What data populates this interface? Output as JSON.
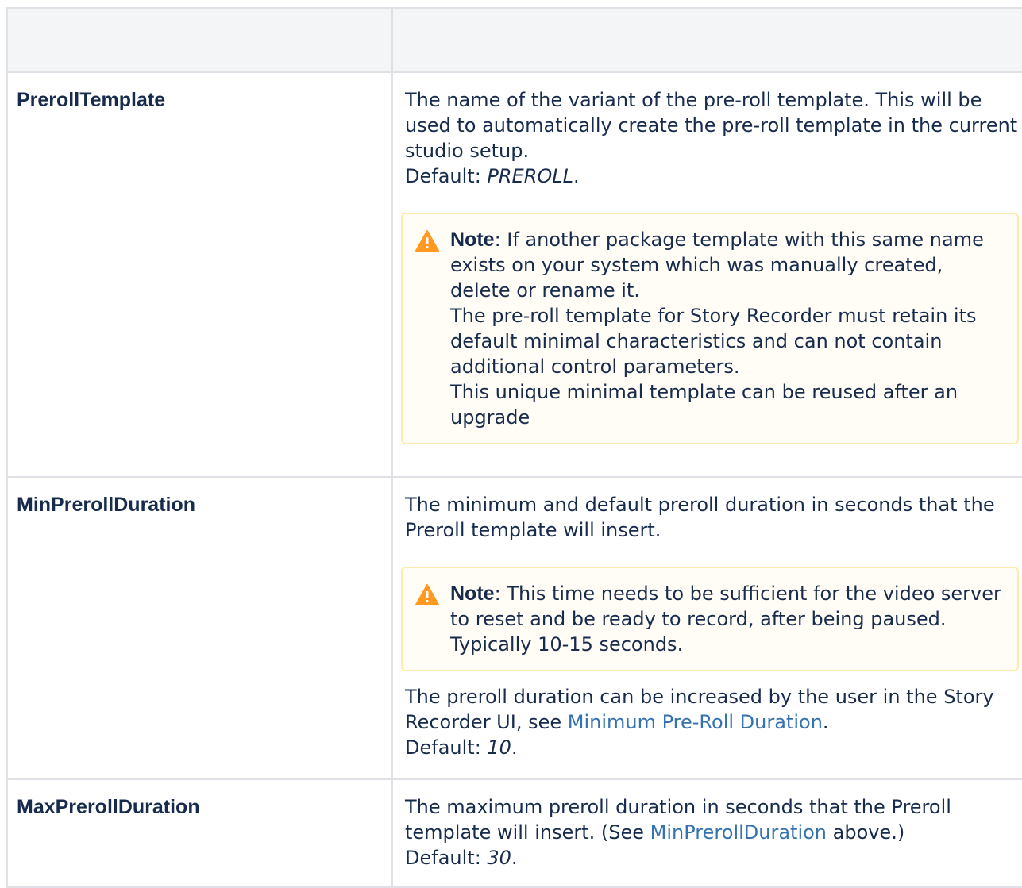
{
  "table": {
    "header": [
      "",
      ""
    ],
    "rows": [
      {
        "name": "PrerollTemplate",
        "description_lines": [
          "The name of the variant of the pre-roll template. This will be used to automatically create the pre-roll template in the current studio setup."
        ],
        "default_label": "Default: ",
        "default_value": "PREROLL",
        "default_suffix": ".",
        "note": {
          "icon": "warning-icon",
          "label": "Note",
          "sep": ": ",
          "text_1": "If another package template with this same name exists on your system which was manually created, delete or rename it.",
          "text_2": "The pre-roll template for Story Recorder must retain its default minimal characteristics and can not contain additional control parameters.",
          "text_3": "This unique minimal template can be reused after an upgrade"
        }
      },
      {
        "name": "MinPrerollDuration",
        "description": "The minimum and default preroll duration in seconds that the Preroll template will insert.",
        "note": {
          "icon": "warning-icon",
          "label": "Note",
          "sep": ": ",
          "text_1": "This time needs to be sufficient for the video server to reset and be ready to record, after being paused. Typically 10-15 seconds."
        },
        "after_note": "The preroll duration can be increased by the user in the Story Recorder UI, see ",
        "link_text": "Minimum Pre-Roll Duration",
        "after_link": ".",
        "default_label": "Default: ",
        "default_value": "10",
        "default_suffix": "."
      },
      {
        "name": "MaxPrerollDuration",
        "description": "The maximum preroll duration in seconds that the Preroll template will insert. (See ",
        "link_text": "MinPrerollDuration",
        "after_link": " above.)",
        "default_label": "Default: ",
        "default_value": "30",
        "default_suffix": "."
      }
    ]
  },
  "colors": {
    "text": "#172b4d",
    "link": "#3572b0",
    "note_bg": "#fffdf6",
    "note_border": "#ffeaae",
    "warning": "#ff991f",
    "header_bg": "#f4f5f7",
    "border": "#dfe1e6"
  }
}
